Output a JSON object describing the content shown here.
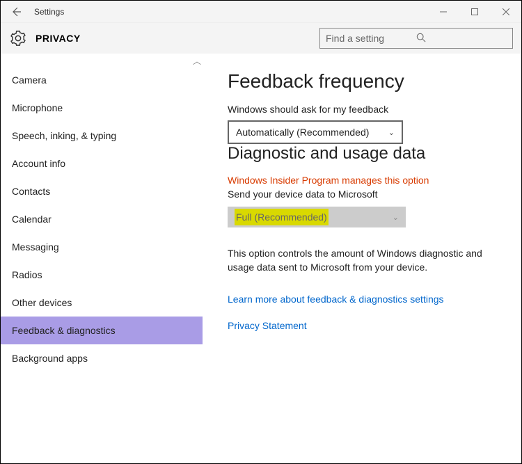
{
  "window": {
    "title": "Settings"
  },
  "header": {
    "section": "PRIVACY"
  },
  "search": {
    "placeholder": "Find a setting"
  },
  "sidebar": {
    "items": [
      {
        "label": "Camera"
      },
      {
        "label": "Microphone"
      },
      {
        "label": "Speech, inking, & typing"
      },
      {
        "label": "Account info"
      },
      {
        "label": "Contacts"
      },
      {
        "label": "Calendar"
      },
      {
        "label": "Messaging"
      },
      {
        "label": "Radios"
      },
      {
        "label": "Other devices"
      },
      {
        "label": "Feedback & diagnostics"
      },
      {
        "label": "Background apps"
      }
    ],
    "selected_index": 9
  },
  "main": {
    "feedback": {
      "heading": "Feedback frequency",
      "label": "Windows should ask for my feedback",
      "value": "Automatically (Recommended)"
    },
    "diag": {
      "heading": "Diagnostic and usage data",
      "warn": "Windows Insider Program manages this option",
      "label": "Send your device data to Microsoft",
      "value": "Full (Recommended)",
      "desc": "This option controls the amount of Windows diagnostic and usage data sent to Microsoft from your device."
    },
    "links": {
      "learn": "Learn more about feedback & diagnostics settings",
      "privacy": "Privacy Statement"
    }
  }
}
